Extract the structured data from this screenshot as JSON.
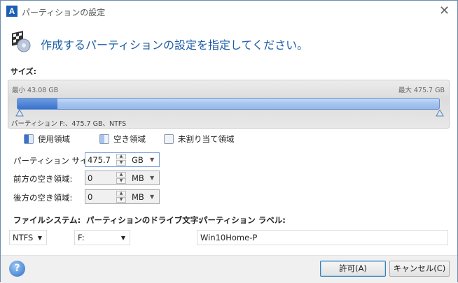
{
  "window": {
    "title": "パーティションの設定",
    "logo": "A",
    "close_icon": "close-icon"
  },
  "heading": "作成するパーティションの設定を指定してください。",
  "size_section": {
    "label": "サイズ:",
    "min_label": "最小 43.08 GB",
    "max_label": "最大 475.7 GB",
    "partition_info": "パーティション F:、475.7 GB、NTFS",
    "used_fraction": 0.095
  },
  "legend": [
    {
      "label": "使用領域",
      "color": "#3a72cc"
    },
    {
      "label": "空き領域",
      "color": "#a7c4ef"
    },
    {
      "label": "未割り当て領域",
      "color": "#f0f0f0"
    }
  ],
  "fields": {
    "partition_size": {
      "label": "パーティション サイズ:",
      "value": "475.7",
      "unit": "GB"
    },
    "free_before": {
      "label": "前方の空き領域:",
      "value": "0",
      "unit": "MB"
    },
    "free_after": {
      "label": "後方の空き領域:",
      "value": "0",
      "unit": "MB"
    }
  },
  "file_system": {
    "label": "ファイルシステム:",
    "value": "NTFS"
  },
  "drive_letter": {
    "label": "パーティションのドライブ文字:",
    "value": "F:"
  },
  "partition_label": {
    "label": "パーティション ラベル:",
    "value": "Win10Home-P"
  },
  "buttons": {
    "ok": "許可(A)",
    "cancel": "キャンセル(C)",
    "help": "?"
  }
}
